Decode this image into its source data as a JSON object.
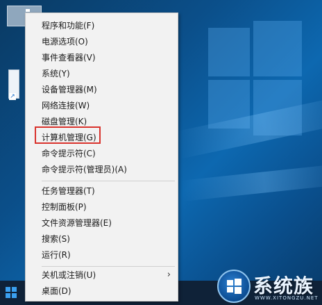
{
  "menu": {
    "group1": [
      {
        "label": "程序和功能(F)"
      },
      {
        "label": "电源选项(O)"
      },
      {
        "label": "事件查看器(V)"
      },
      {
        "label": "系统(Y)"
      },
      {
        "label": "设备管理器(M)"
      },
      {
        "label": "网络连接(W)"
      },
      {
        "label": "磁盘管理(K)"
      },
      {
        "label": "计算机管理(G)"
      },
      {
        "label": "命令提示符(C)"
      },
      {
        "label": "命令提示符(管理员)(A)"
      }
    ],
    "group2": [
      {
        "label": "任务管理器(T)"
      },
      {
        "label": "控制面板(P)"
      },
      {
        "label": "文件资源管理器(E)"
      },
      {
        "label": "搜索(S)"
      },
      {
        "label": "运行(R)"
      }
    ],
    "group3": [
      {
        "label": "关机或注销(U)",
        "submenu_arrow": "›"
      },
      {
        "label": "桌面(D)"
      }
    ]
  },
  "highlighted_item": "计算机管理(G)",
  "watermark": {
    "brand": "系统族",
    "subtext": "WWW.XITONGZU.NET"
  },
  "colors": {
    "menu_bg": "#f2f2f2",
    "highlight_border": "#d9322c",
    "desktop_blue": "#0b4f8a",
    "taskbar": "#0f2238"
  },
  "icons": {
    "start": "windows-logo-icon",
    "submenu": "chevron-right-icon"
  }
}
